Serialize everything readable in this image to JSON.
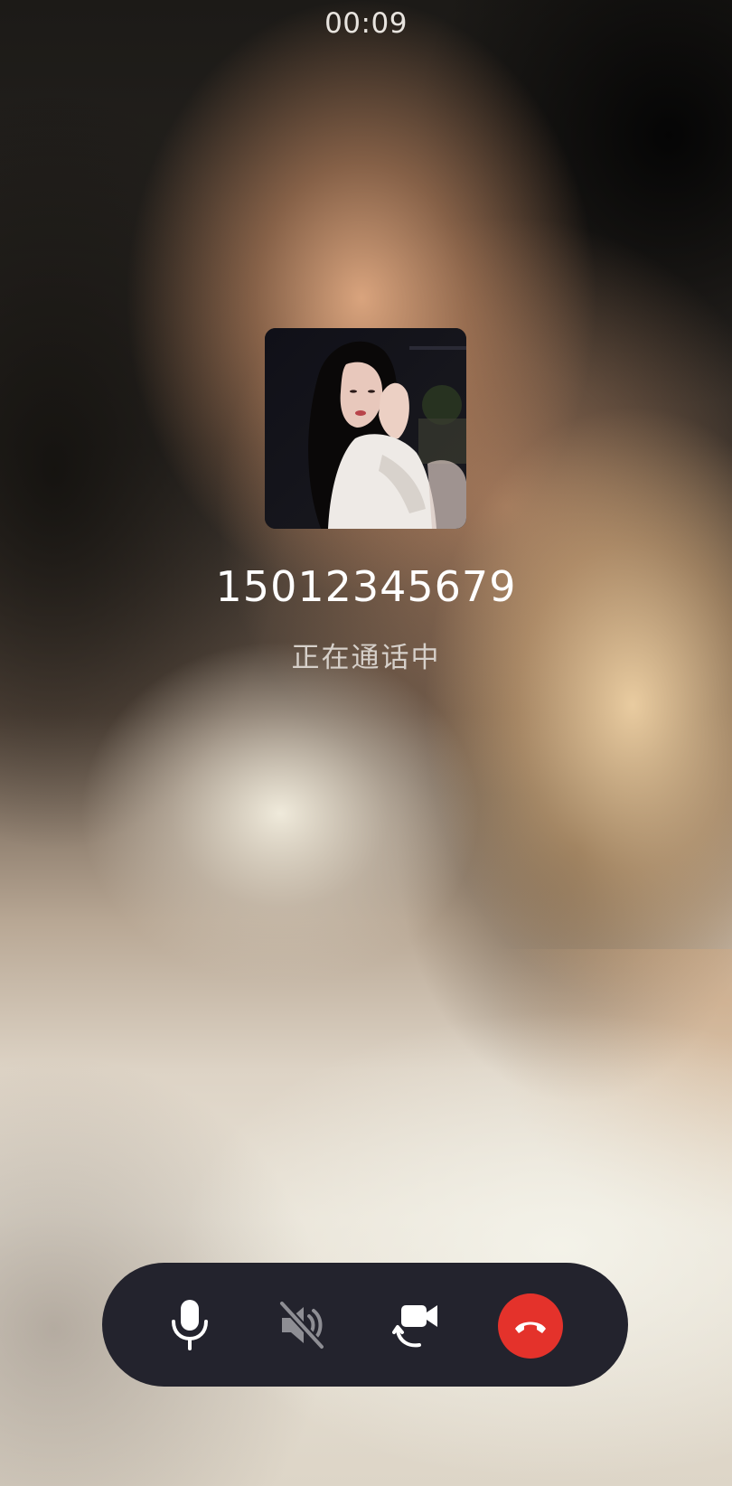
{
  "call": {
    "timer": "00:09",
    "number": "15012345679",
    "status": "正在通话中"
  },
  "controls": [
    {
      "name": "microphone",
      "icon": "microphone-icon",
      "state": "on"
    },
    {
      "name": "speaker",
      "icon": "speaker-muted-icon",
      "state": "disabled"
    },
    {
      "name": "switch-to-video",
      "icon": "video-camera-switch-icon"
    },
    {
      "name": "hang-up",
      "icon": "phone-hangup-icon"
    }
  ],
  "colors": {
    "controlBar": "#23232d",
    "hangup": "#e4322b",
    "iconActive": "#ffffff",
    "iconDisabled": "#8e8e94"
  }
}
